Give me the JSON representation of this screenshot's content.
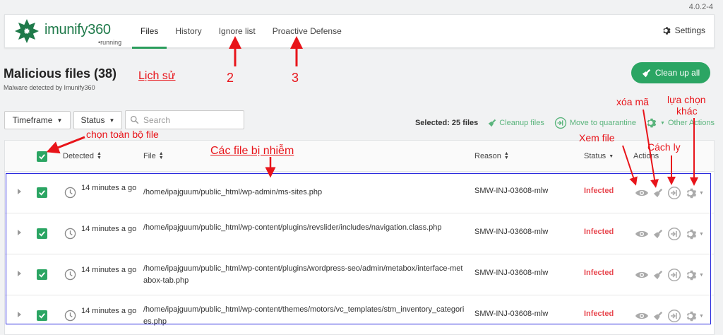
{
  "version": "4.0.2-4",
  "brand": {
    "name": "imunify360",
    "status": "running"
  },
  "nav": [
    {
      "label": "Files",
      "active": true
    },
    {
      "label": "History",
      "active": false
    },
    {
      "label": "Ignore list",
      "active": false
    },
    {
      "label": "Proactive Defense",
      "active": false
    }
  ],
  "settings_label": "Settings",
  "page": {
    "title": "Malicious files (38)",
    "subtitle": "Malware detected by Imunify360"
  },
  "cleanup_all_label": "Clean up all",
  "filters": {
    "timeframe": "Timeframe",
    "status": "Status",
    "search_placeholder": "Search"
  },
  "toolbar": {
    "selected": "Selected: 25 files",
    "cleanup": "Cleanup files",
    "quarantine": "Move to quarantine",
    "other": "Other Actions"
  },
  "table": {
    "headers": {
      "detected": "Detected",
      "file": "File",
      "reason": "Reason",
      "status": "Status",
      "actions": "Actions"
    },
    "rows": [
      {
        "detected": "14 minutes a go",
        "file": "/home/ipajguum/public_html/wp-admin/ms-sites.php",
        "reason": "SMW-INJ-03608-mlw",
        "status": "Infected"
      },
      {
        "detected": "14 minutes a go",
        "file": "/home/ipajguum/public_html/wp-content/plugins/revslider/includes/navigation.class.php",
        "reason": "SMW-INJ-03608-mlw",
        "status": "Infected"
      },
      {
        "detected": "14 minutes a go",
        "file": "/home/ipajguum/public_html/wp-content/plugins/wordpress-seo/admin/metabox/interface-metabox-tab.php",
        "reason": "SMW-INJ-03608-mlw",
        "status": "Infected"
      },
      {
        "detected": "14 minutes a go",
        "file": "/home/ipajguum/public_html/wp-content/themes/motors/vc_templates/stm_inventory_categories.php",
        "reason": "SMW-INJ-03608-mlw",
        "status": "Infected"
      }
    ]
  },
  "annotations": {
    "lich_su": "Lịch sử",
    "num2": "2",
    "num3": "3",
    "chon_toan_bo": "chọn toàn bộ file",
    "cac_file": "Các file bị nhiễm",
    "xem_file": "Xem file",
    "xoa_ma": "xóa mã",
    "cach_ly": "Cách ly",
    "lua_chon": "lựa chọn",
    "khac": "khác"
  },
  "colors": {
    "accent": "#2ba563",
    "infected": "#e8474f",
    "annotation": "#e8141a",
    "frame": "#2b2bdd"
  },
  "icons": [
    "imunify-logo-icon",
    "gear-icon",
    "broom-icon",
    "caret-down-icon",
    "search-icon",
    "sort-icon",
    "clock-icon",
    "eye-icon",
    "quarantine-icon",
    "check-icon"
  ]
}
